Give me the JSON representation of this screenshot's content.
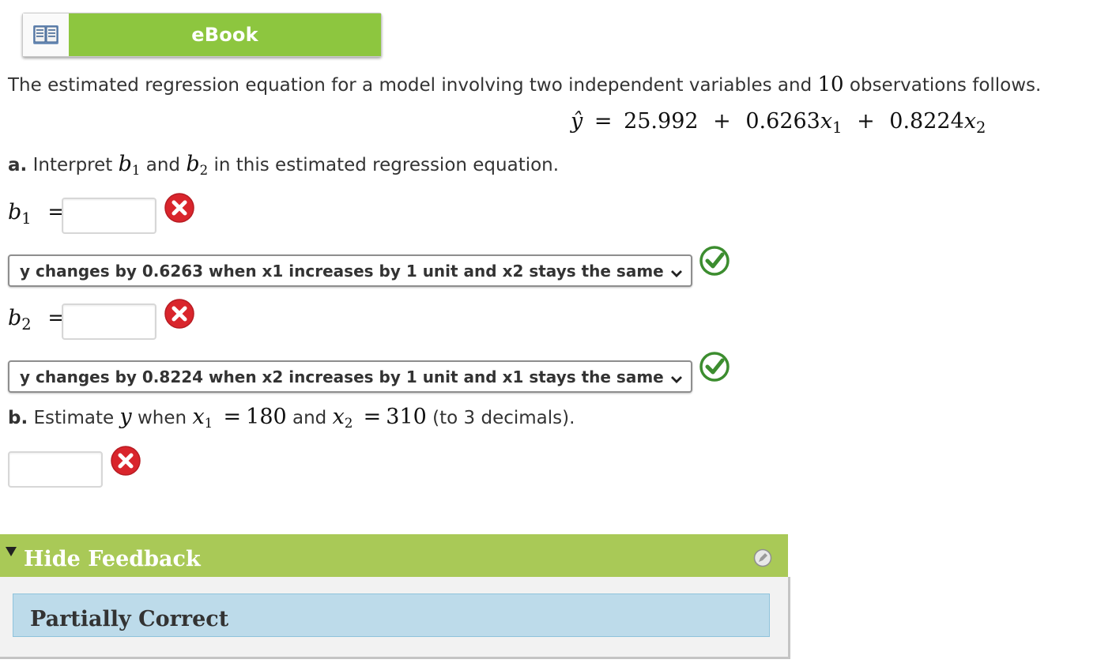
{
  "ebook": {
    "label": "eBook"
  },
  "intro": {
    "text_before": "The estimated regression equation for a model involving two independent variables and",
    "n": "10",
    "text_after": "observations follows."
  },
  "equation": {
    "yhat": "ŷ",
    "eq": "=",
    "b0": "25.992",
    "plus1": "+",
    "b1": "0.6263",
    "x1": "x",
    "x1_sub": "1",
    "plus2": "+",
    "b2": "0.8224",
    "x2": "x",
    "x2_sub": "2"
  },
  "part_a": {
    "letter": "a.",
    "text_interpret": "Interpret",
    "b1_var": "b",
    "b1_sub": "1",
    "text_and": "and",
    "b2_var": "b",
    "b2_sub": "2",
    "text_rest": "in this estimated regression equation.",
    "b1_label_var": "b",
    "b1_label_sub": "1",
    "b1_label_eq": "=",
    "b1_input_value": "",
    "b1_status": "incorrect",
    "b1_select_value": "y changes by 0.6263 when x1 increases by 1 unit and x2 stays the same",
    "b1_select_status": "correct",
    "b2_label_var": "b",
    "b2_label_sub": "2",
    "b2_label_eq": "=",
    "b2_input_value": "",
    "b2_status": "incorrect",
    "b2_select_value": "y changes by 0.8224 when x2 increases by 1 unit and x1 stays the same",
    "b2_select_status": "correct"
  },
  "part_b": {
    "letter": "b.",
    "text_estimate": "Estimate",
    "y_var": "y",
    "text_when": "when",
    "x1_var": "x",
    "x1_sub": "1",
    "eq1": "=",
    "x1_val": "180",
    "text_and": "and",
    "x2_var": "x",
    "x2_sub": "2",
    "eq2": "=",
    "x2_val": "310",
    "text_note": "(to 3 decimals).",
    "input_value": "",
    "status": "incorrect"
  },
  "feedback": {
    "toggle_label": "Hide Feedback",
    "status_text": "Partially Correct"
  },
  "colors": {
    "ebook_green": "#8dc63f",
    "feedback_green": "#a9c957",
    "feedback_box": "#bddbea",
    "correct_green": "#3c8d2f",
    "incorrect_red": "#d9252c"
  }
}
